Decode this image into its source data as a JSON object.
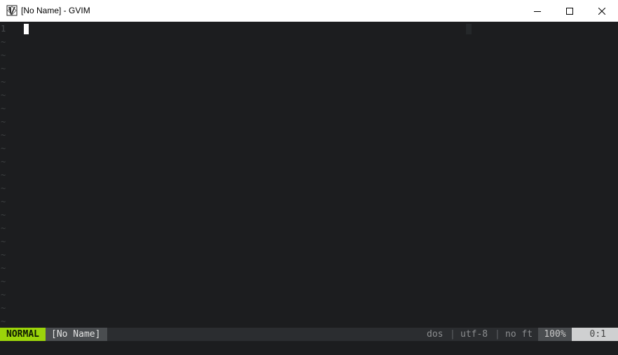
{
  "window": {
    "title": "[No Name] - GVIM",
    "icon": "gvim-icon",
    "controls": [
      "minimize-icon",
      "maximize-icon",
      "close-icon"
    ]
  },
  "editor": {
    "line_number": "1",
    "tilde": "~",
    "tilde_rows": 22,
    "colors": {
      "background": "#1c1d1f",
      "cursor": "#ffffff"
    }
  },
  "statusline": {
    "mode": "NORMAL",
    "buffer_name": "[No Name]",
    "fileformat": "dos",
    "separator": "|",
    "encoding": "utf-8",
    "filetype": "no ft",
    "percent": "100%",
    "position": "0:1",
    "colors": {
      "mode_bg": "#9bd40a",
      "position_bg": "#cfd0d1"
    }
  }
}
